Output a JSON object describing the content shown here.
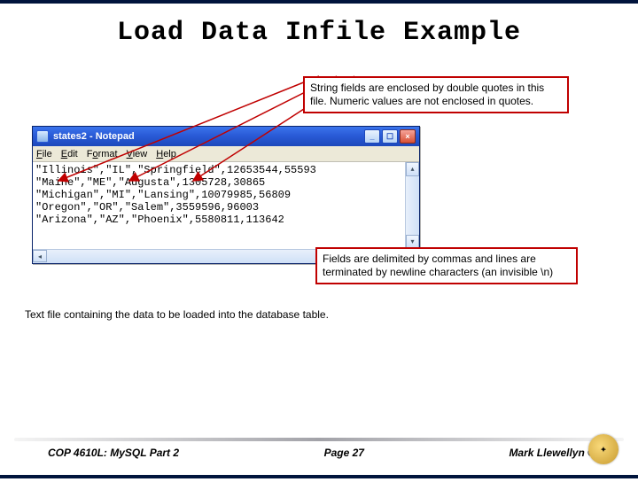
{
  "title": "Load Data Infile Example",
  "callouts": {
    "strings": "String fields are enclosed by double quotes in this file.  Numeric values are not enclosed in quotes.",
    "delimiters": "Fields are delimited by commas and lines are terminated by newline characters (an invisible \\n)",
    "textfile": "Text file containing the data to be loaded into the database table."
  },
  "notepad": {
    "window_title": "states2 - Notepad",
    "menus": {
      "file": "File",
      "edit": "Edit",
      "format": "Format",
      "view": "View",
      "help": "Help"
    },
    "content": "\"Illinois\",\"IL\",\"Springfield\",12653544,55593\n\"Maine\",\"ME\",\"Augusta\",1305728,30865\n\"Michigan\",\"MI\",\"Lansing\",10079985,56809\n\"Oregon\",\"OR\",\"Salem\",3559596,96003\n\"Arizona\",\"AZ\",\"Phoenix\",5580811,113642"
  },
  "footer": {
    "left": "COP 4610L: MySQL Part 2",
    "center": "Page 27",
    "right": "Mark Llewellyn ©"
  }
}
